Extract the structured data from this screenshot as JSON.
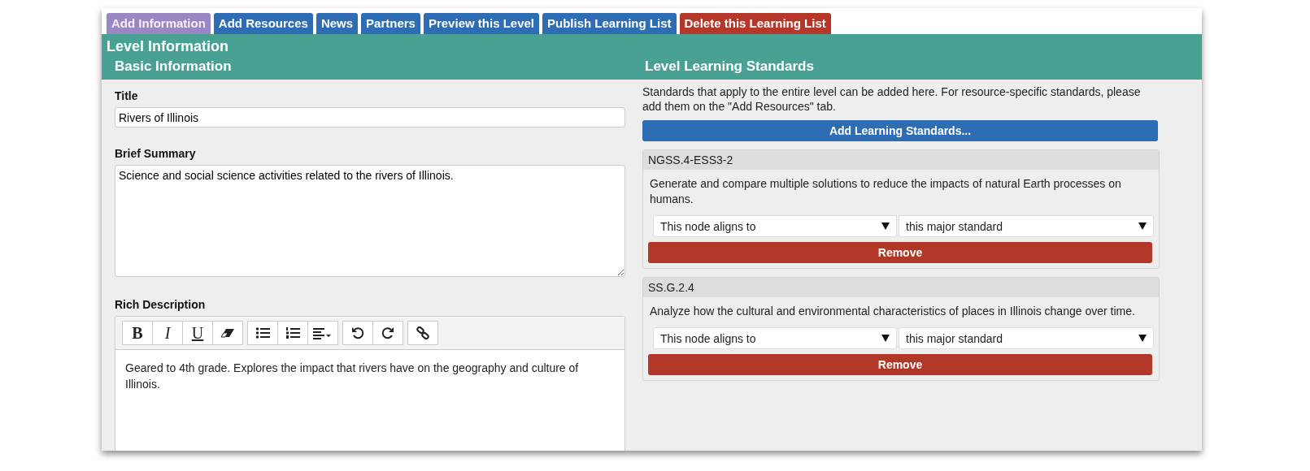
{
  "tabs": [
    {
      "label": "Add Information",
      "selected": true,
      "kind": "normal"
    },
    {
      "label": "Add Resources",
      "selected": false,
      "kind": "normal"
    },
    {
      "label": "News",
      "selected": false,
      "kind": "normal"
    },
    {
      "label": "Partners",
      "selected": false,
      "kind": "normal"
    },
    {
      "label": "Preview this Level",
      "selected": false,
      "kind": "normal"
    },
    {
      "label": "Publish Learning List",
      "selected": false,
      "kind": "normal"
    },
    {
      "label": "Delete this Learning List",
      "selected": false,
      "kind": "danger"
    }
  ],
  "panel_title": "Level Information",
  "basic": {
    "heading": "Basic Information",
    "title_label": "Title",
    "title_value": "Rivers of Illinois",
    "summary_label": "Brief Summary",
    "summary_value": "Science and social science activities related to the rivers of Illinois.",
    "rich_label": "Rich Description",
    "toolbar": [
      [
        {
          "kind": "bold",
          "label": "B"
        },
        {
          "kind": "italic",
          "label": "I"
        },
        {
          "kind": "underline",
          "label": "U"
        },
        {
          "kind": "eraser"
        }
      ],
      [
        {
          "kind": "bullets"
        },
        {
          "kind": "numbers"
        },
        {
          "kind": "align"
        }
      ],
      [
        {
          "kind": "undo"
        },
        {
          "kind": "redo"
        }
      ],
      [
        {
          "kind": "link"
        }
      ]
    ],
    "rich_value": "Geared to 4th grade. Explores the impact that rivers have on the geography and culture of Illinois."
  },
  "standards": {
    "heading": "Level Learning Standards",
    "intro": "Standards that apply to the entire level can be added here. For resource-specific standards, please add them on the \"Add Resources\" tab.",
    "add_button": "Add Learning Standards...",
    "items": [
      {
        "code": "NGSS.4-ESS3-2",
        "description": "Generate and compare multiple solutions to reduce the impacts of natural Earth processes on humans.",
        "alignment": "This node aligns to",
        "scope": "this major standard",
        "remove": "Remove"
      },
      {
        "code": "SS.G.2.4",
        "description": "Analyze how the cultural and environmental characteristics of places in Illinois change over time.",
        "alignment": "This node aligns to",
        "scope": "this major standard",
        "remove": "Remove"
      }
    ]
  }
}
